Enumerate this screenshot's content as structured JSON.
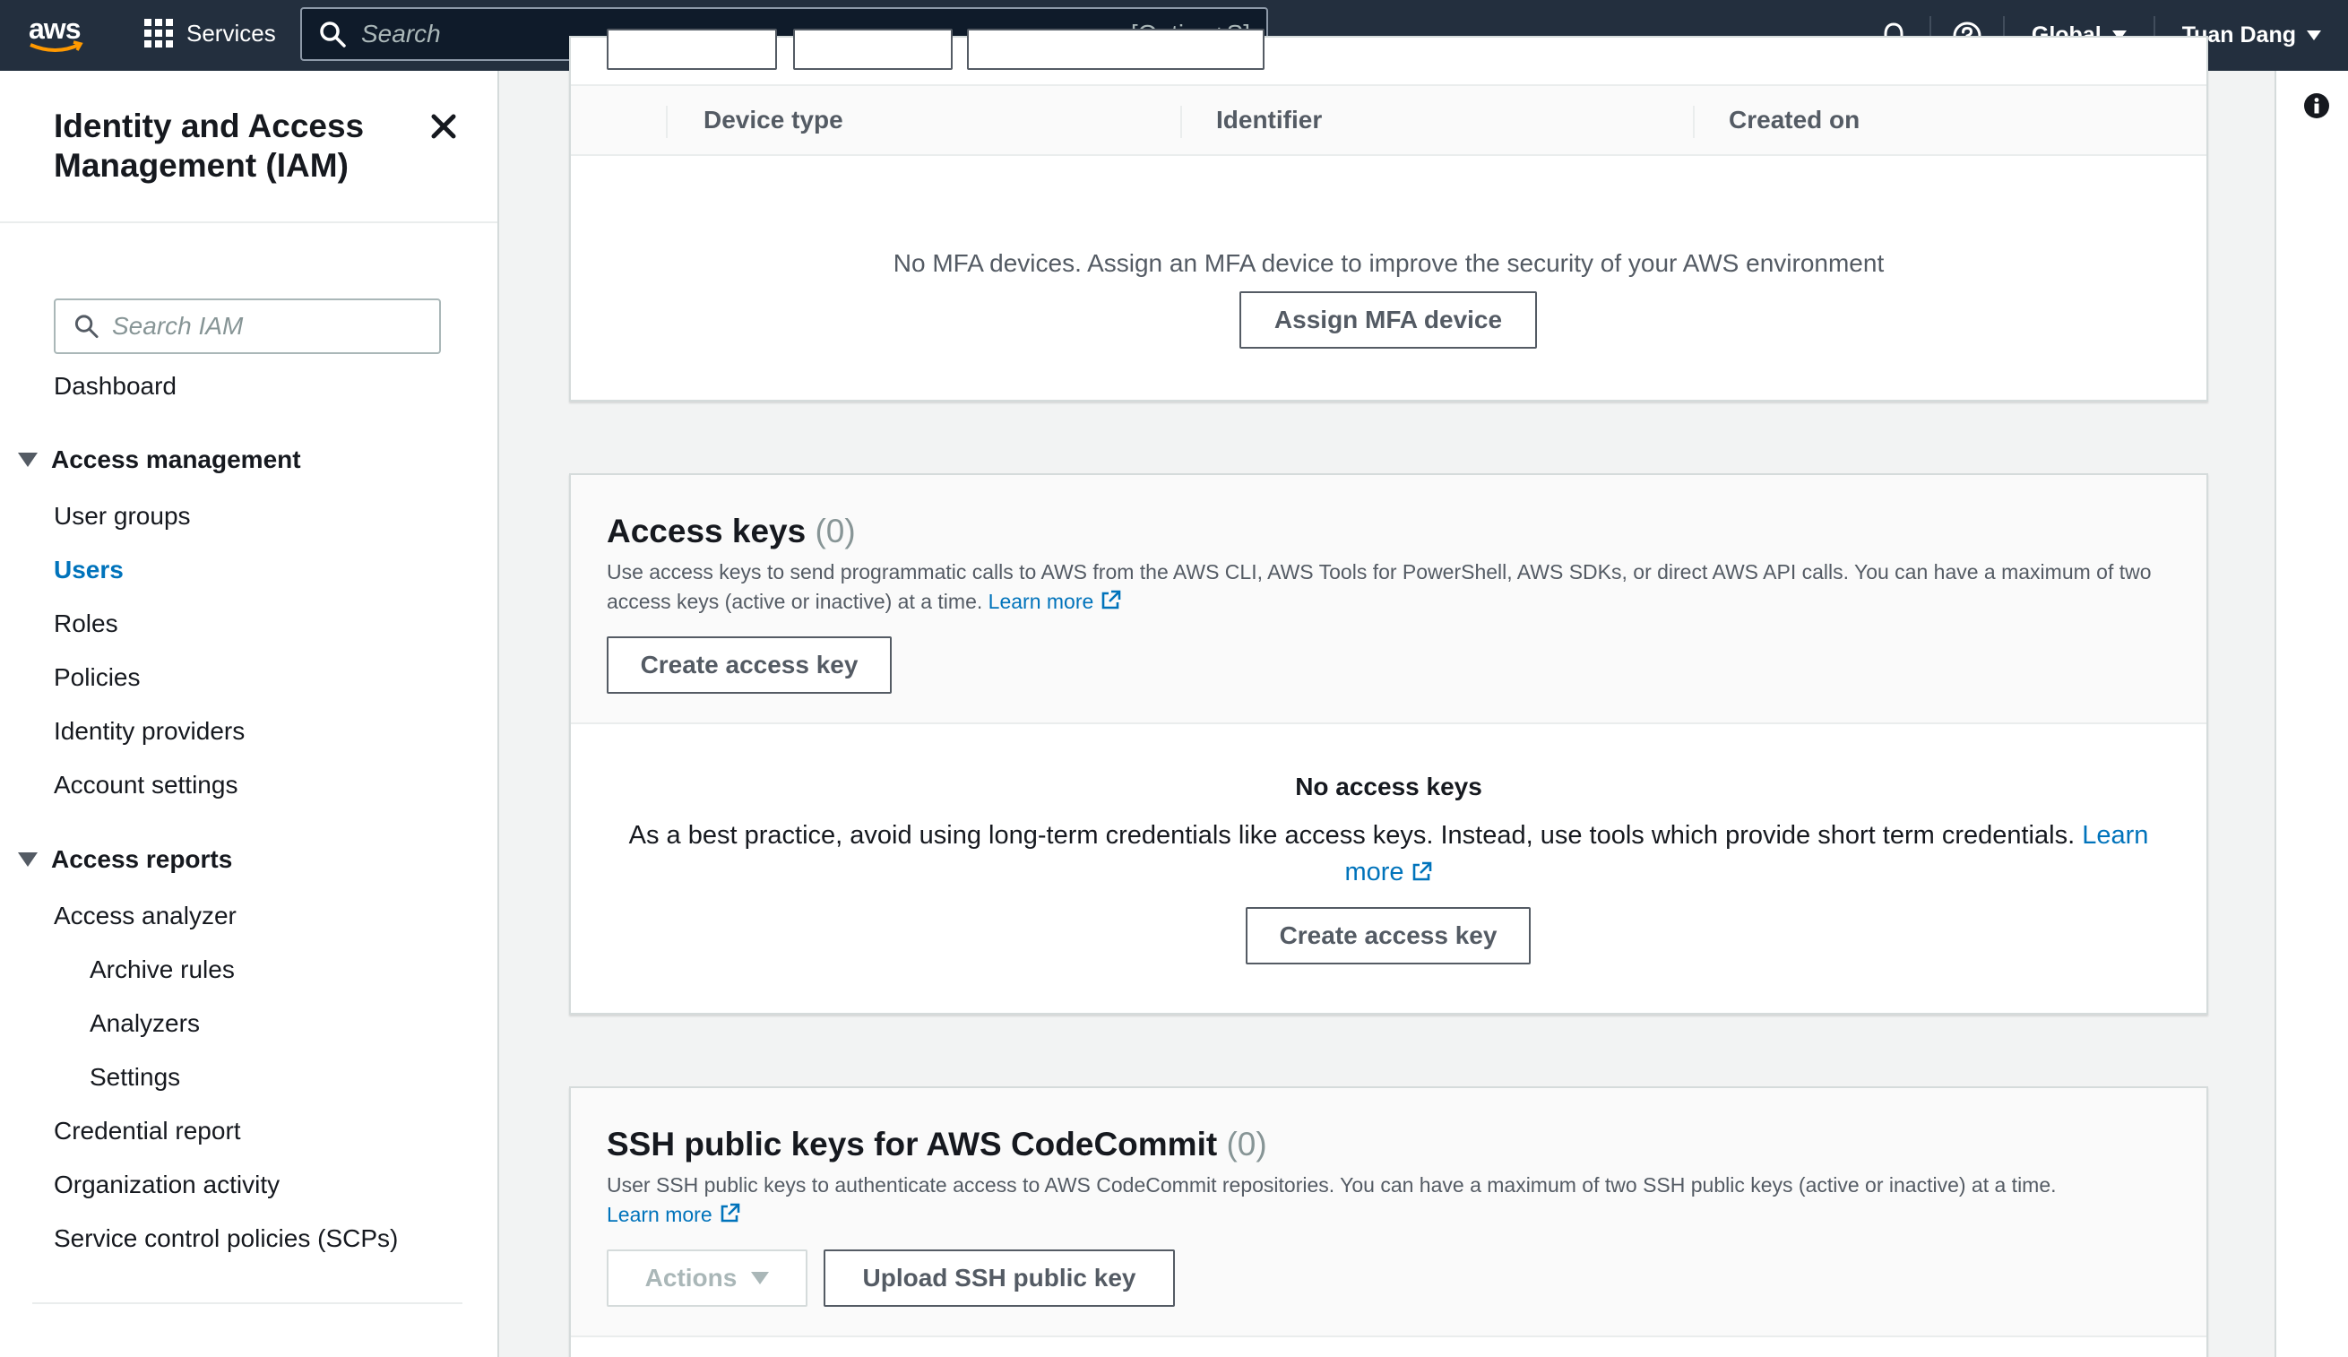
{
  "topnav": {
    "logo_text": "aws",
    "services_label": "Services",
    "search_placeholder": "Search",
    "search_shortcut": "[Option+S]",
    "region": "Global",
    "user": "Tuan Dang"
  },
  "sidebar": {
    "title": "Identity and Access Management (IAM)",
    "search_placeholder": "Search IAM",
    "dashboard": "Dashboard",
    "access_management": {
      "label": "Access management",
      "items": [
        "User groups",
        "Users",
        "Roles",
        "Policies",
        "Identity providers",
        "Account settings"
      ],
      "active": "Users"
    },
    "access_reports": {
      "label": "Access reports",
      "analyzer": "Access analyzer",
      "analyzer_items": [
        "Archive rules",
        "Analyzers",
        "Settings"
      ],
      "items": [
        "Credential report",
        "Organization activity",
        "Service control policies (SCPs)"
      ]
    }
  },
  "mfa": {
    "columns": [
      "Device type",
      "Identifier",
      "Created on"
    ],
    "empty_text": "No MFA devices. Assign an MFA device to improve the security of your AWS environment",
    "assign_button": "Assign MFA device"
  },
  "access_keys": {
    "title": "Access keys",
    "count": "(0)",
    "description": "Use access keys to send programmatic calls to AWS from the AWS CLI, AWS Tools for PowerShell, AWS SDKs, or direct AWS API calls. You can have a maximum of two access keys (active or inactive) at a time.",
    "learn_more": "Learn more",
    "create_button": "Create access key",
    "empty_title": "No access keys",
    "empty_text": "As a best practice, avoid using long-term credentials like access keys. Instead, use tools which provide short term credentials.",
    "empty_learn_more": "Learn more",
    "empty_create_button": "Create access key"
  },
  "ssh": {
    "title": "SSH public keys for AWS CodeCommit",
    "count": "(0)",
    "description": "User SSH public keys to authenticate access to AWS CodeCommit repositories. You can have a maximum of two SSH public keys (active or inactive) at a time.",
    "learn_more": "Learn more",
    "actions_button": "Actions",
    "upload_button": "Upload SSH public key"
  },
  "colors": {
    "nav_bg": "#232f3e",
    "link": "#0073bb",
    "smile": "#ff9900"
  }
}
